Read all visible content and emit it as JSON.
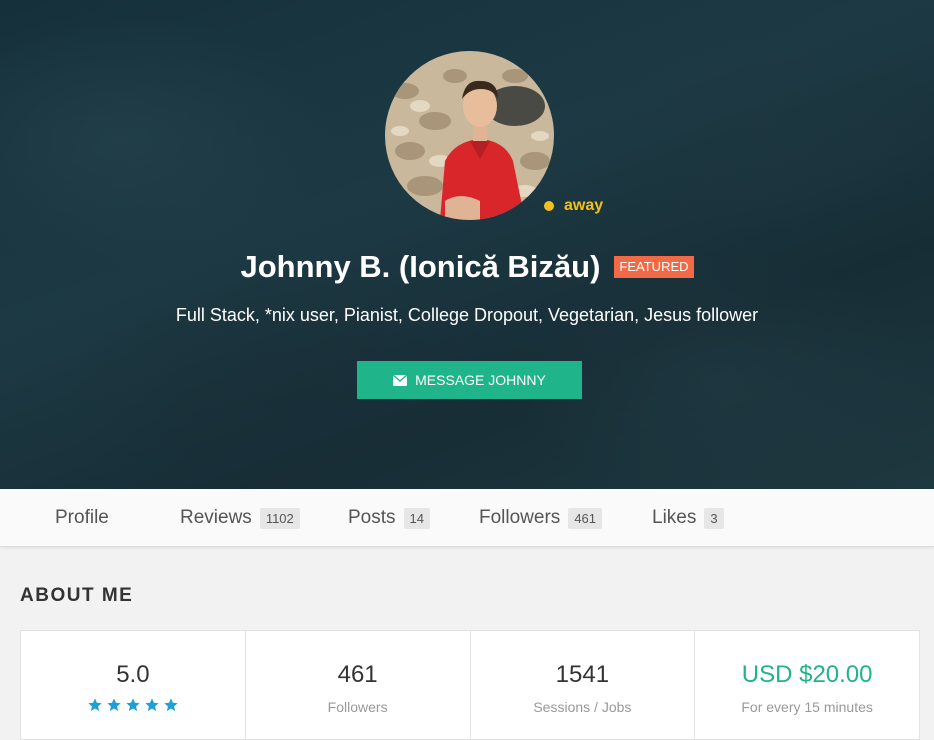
{
  "profile": {
    "name": "Johnny B. (Ionică Bizău)",
    "badge": "FEATURED",
    "status": "away",
    "tagline": "Full Stack, *nix user, Pianist, College Dropout, Vegetarian, Jesus follower",
    "message_button": "MESSAGE JOHNNY",
    "status_color": "#f2c21b",
    "accent_color": "#1fb489",
    "badge_color": "#f16a45"
  },
  "tabs": [
    {
      "label": "Profile",
      "count": null
    },
    {
      "label": "Reviews",
      "count": "1102"
    },
    {
      "label": "Posts",
      "count": "14"
    },
    {
      "label": "Followers",
      "count": "461"
    },
    {
      "label": "Likes",
      "count": "3"
    }
  ],
  "about": {
    "title": "ABOUT ME",
    "stats": [
      {
        "value": "5.0",
        "label": "",
        "rating_stars": 5
      },
      {
        "value": "461",
        "label": "Followers"
      },
      {
        "value": "1541",
        "label": "Sessions / Jobs"
      },
      {
        "value": "USD $20.00",
        "label": "For every 15 minutes"
      }
    ]
  },
  "icons": {
    "message": "envelope-icon",
    "star": "star-icon"
  }
}
